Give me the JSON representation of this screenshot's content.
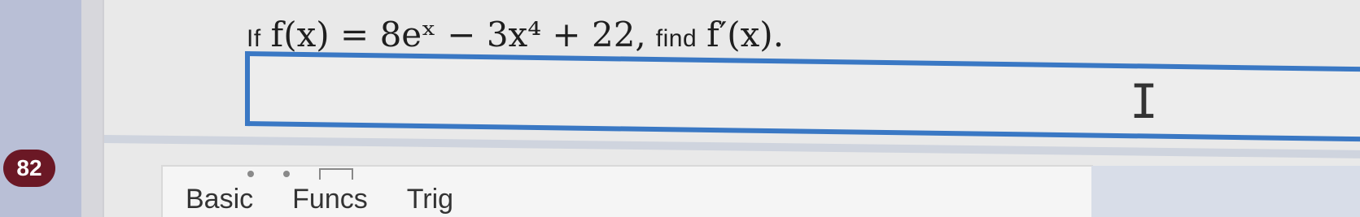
{
  "question": {
    "prefix": "If",
    "function_expression": "f(x) = 8eˣ − 3x⁴ + 22,",
    "find_word": "find",
    "target_expression": "f′(x)."
  },
  "answer": {
    "value": "",
    "placeholder": ""
  },
  "question_number": "82",
  "keyboard": {
    "tabs": [
      "Basic",
      "Funcs",
      "Trig"
    ]
  },
  "colors": {
    "answer_border": "#3a78c4",
    "badge": "#6b1825",
    "sidebar": "#b9bfd6"
  },
  "icons": {
    "cursor": "text-cursor-icon",
    "toolbar": [
      "dot-icon",
      "dot-icon",
      "box-icon"
    ]
  }
}
